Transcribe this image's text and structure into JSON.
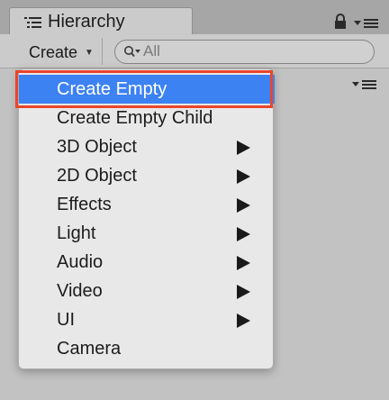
{
  "tab": {
    "title": "Hierarchy",
    "icon": "list-icon"
  },
  "tab_controls": {
    "lock_icon": "lock-icon",
    "menu_icon": "tab-menu-icon"
  },
  "toolbar": {
    "create_label": "Create",
    "create_caret": "▼",
    "search_placeholder": "All",
    "search_value": ""
  },
  "menu": {
    "items": [
      {
        "label": "Create Empty",
        "submenu": false,
        "selected": true
      },
      {
        "label": "Create Empty Child",
        "submenu": false,
        "selected": false
      },
      {
        "label": "3D Object",
        "submenu": true,
        "selected": false
      },
      {
        "label": "2D Object",
        "submenu": true,
        "selected": false
      },
      {
        "label": "Effects",
        "submenu": true,
        "selected": false
      },
      {
        "label": "Light",
        "submenu": true,
        "selected": false
      },
      {
        "label": "Audio",
        "submenu": true,
        "selected": false
      },
      {
        "label": "Video",
        "submenu": true,
        "selected": false
      },
      {
        "label": "UI",
        "submenu": true,
        "selected": false
      },
      {
        "label": "Camera",
        "submenu": false,
        "selected": false
      }
    ]
  },
  "colors": {
    "selection": "#3d82f2",
    "highlight_outline": "#e9462c",
    "menu_background": "#e8e8e8",
    "panel_background": "#c2c2c2"
  }
}
